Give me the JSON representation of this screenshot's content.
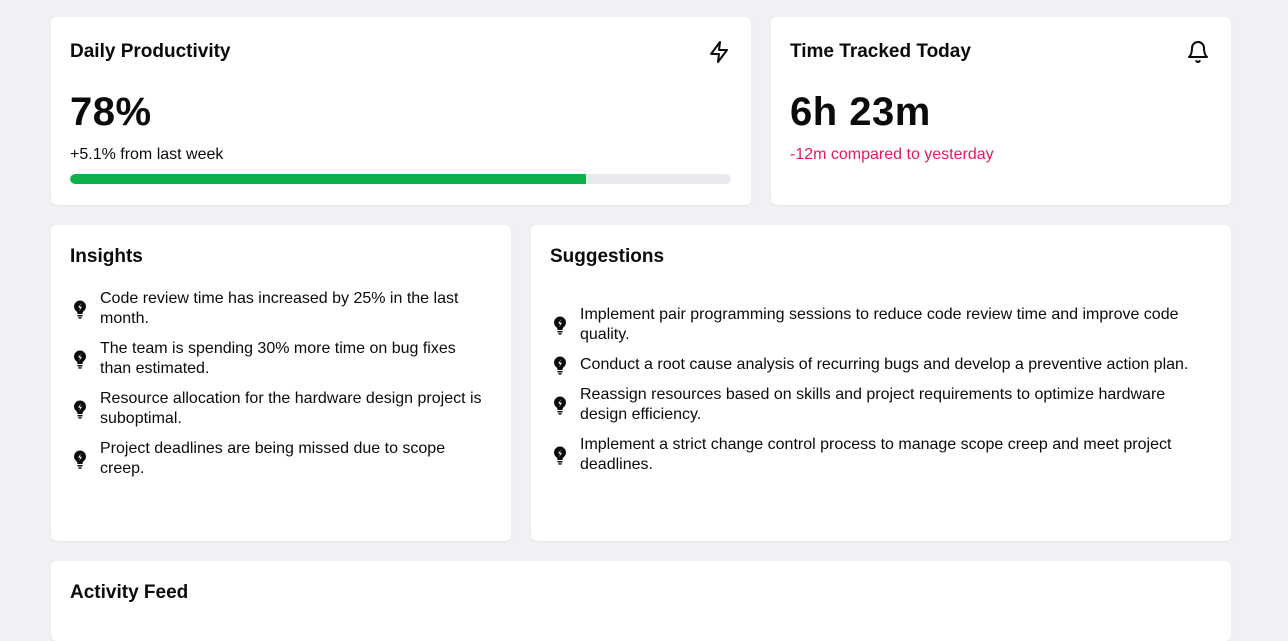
{
  "productivity": {
    "title": "Daily Productivity",
    "icon": "lightning-icon",
    "value": "78%",
    "progress_fraction": 0.78,
    "delta": "+5.1% from last week",
    "progress_color": "#0bb24c"
  },
  "time_tracked": {
    "title": "Time Tracked Today",
    "icon": "bell-icon",
    "value": "6h 23m",
    "delta": "-12m compared to yesterday",
    "delta_color": "#e11d5c"
  },
  "insights": {
    "title": "Insights",
    "item_icon": "lightbulb-icon",
    "items": [
      "Code review time has increased by 25% in the last month.",
      "The team is spending 30% more time on bug fixes than estimated.",
      "Resource allocation for the hardware design project is suboptimal.",
      "Project deadlines are being missed due to scope creep."
    ]
  },
  "suggestions": {
    "title": "Suggestions",
    "item_icon": "lightbulb-icon",
    "items": [
      "Implement pair programming sessions to reduce code review time and improve code quality.",
      "Conduct a root cause analysis of recurring bugs and develop a preventive action plan.",
      "Reassign resources based on skills and project requirements to optimize hardware design efficiency.",
      "Implement a strict change control process to manage scope creep and meet project deadlines."
    ]
  },
  "activity_feed": {
    "title": "Activity Feed"
  }
}
